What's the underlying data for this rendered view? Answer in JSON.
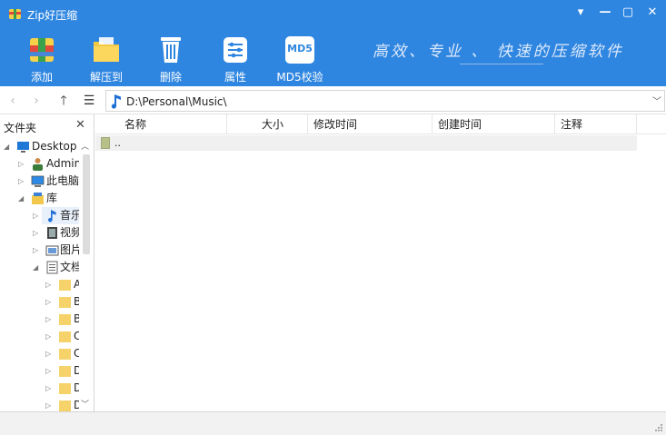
{
  "app": {
    "title": "Zip好压缩",
    "slogan": "高效、专业 、 快速的压缩软件"
  },
  "window_controls": {
    "menu": "▾",
    "minimize": "—",
    "maximize": "▢",
    "close": "✕"
  },
  "toolbar": {
    "add": "添加",
    "extract": "解压到",
    "delete": "删除",
    "properties": "属性",
    "md5": "MD5校验",
    "md5_icon_text": "MD5"
  },
  "address": {
    "path": "D:\\Personal\\Music\\"
  },
  "left_pane": {
    "title": "文件夹",
    "tree": [
      {
        "label": "Desktop",
        "icon": "desktop-icon"
      },
      {
        "label": "Admin",
        "icon": "user-icon"
      },
      {
        "label": "此电脑",
        "icon": "computer-icon"
      },
      {
        "label": "库",
        "icon": "library-icon"
      },
      {
        "label": "音乐",
        "icon": "music-icon"
      },
      {
        "label": "视频",
        "icon": "video-icon"
      },
      {
        "label": "图片",
        "icon": "picture-icon"
      },
      {
        "label": "文档",
        "icon": "document-icon"
      },
      {
        "label": "A",
        "icon": "folder-icon"
      },
      {
        "label": "B",
        "icon": "folder-icon"
      },
      {
        "label": "B",
        "icon": "folder-icon"
      },
      {
        "label": "C",
        "icon": "folder-icon"
      },
      {
        "label": "C",
        "icon": "folder-icon"
      },
      {
        "label": "D",
        "icon": "folder-icon"
      },
      {
        "label": "D",
        "icon": "folder-icon"
      },
      {
        "label": "D",
        "icon": "folder-icon"
      }
    ]
  },
  "file_list": {
    "columns": [
      "名称",
      "大小",
      "修改时间",
      "创建时间",
      "注释"
    ],
    "rows": [
      {
        "name": ".."
      }
    ]
  },
  "colors": {
    "accent": "#2f86e0",
    "selection": "#e8f0fb"
  }
}
